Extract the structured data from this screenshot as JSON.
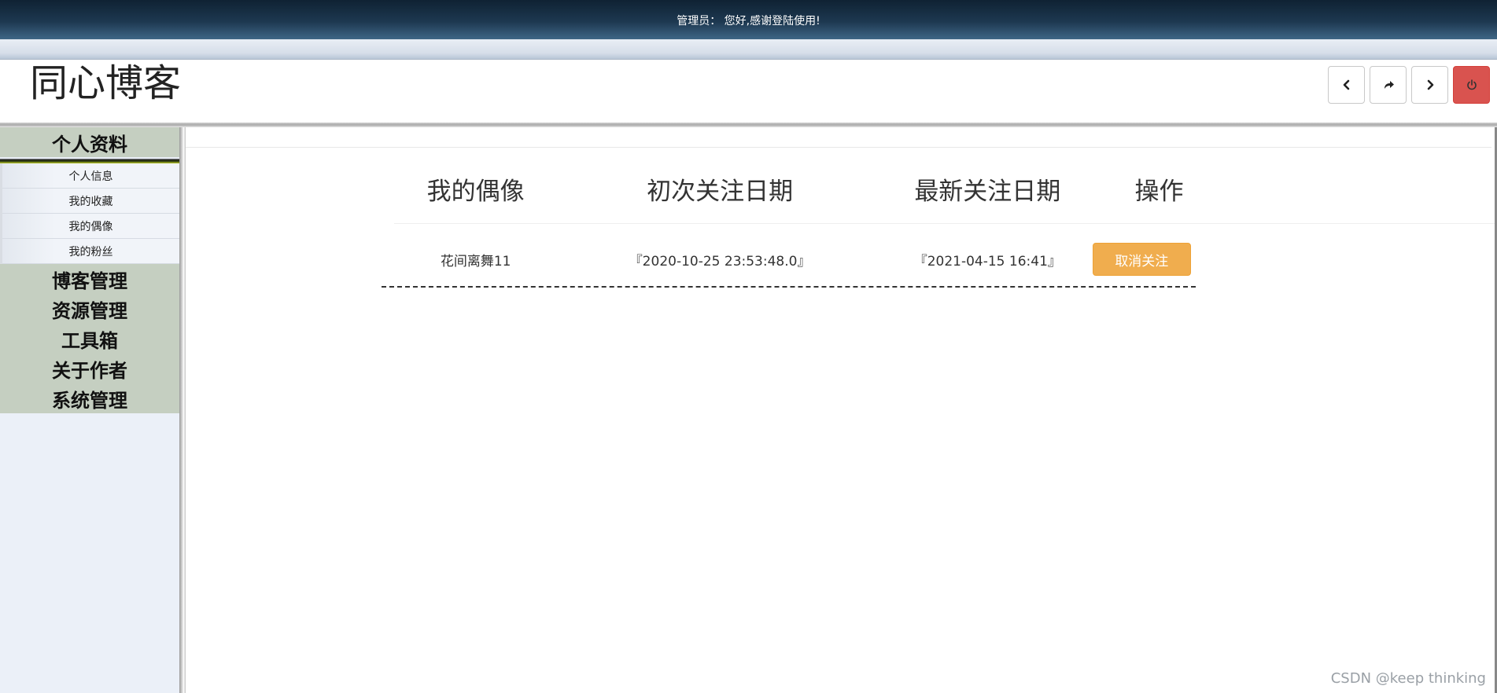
{
  "topbar": {
    "greeting": "管理员： 您好,感谢登陆使用!"
  },
  "header": {
    "site_title": "同心博客",
    "nav": {
      "back_icon": "chevron-left-icon",
      "forward_icon": "share-arrow-icon",
      "next_icon": "chevron-right-icon",
      "power_icon": "power-icon"
    }
  },
  "sidebar": {
    "group_profile": "个人资料",
    "profile_items": [
      "个人信息",
      "我的收藏",
      "我的偶像",
      "我的粉丝"
    ],
    "groups": [
      "博客管理",
      "资源管理",
      "工具箱",
      "关于作者",
      "系统管理"
    ]
  },
  "table": {
    "headers": [
      "我的偶像",
      "初次关注日期",
      "最新关注日期",
      "操作"
    ],
    "rows": [
      {
        "idol": "花间离舞11",
        "first_date": "『2020-10-25 23:53:48.0』",
        "latest_date": "『2021-04-15 16:41』",
        "action": "取消关注"
      }
    ]
  },
  "watermark": "CSDN @keep   thinking",
  "colors": {
    "accent_orange": "#f0ad4e",
    "danger_red": "#d9534f",
    "sidebar_green": "#c5cfc1"
  }
}
